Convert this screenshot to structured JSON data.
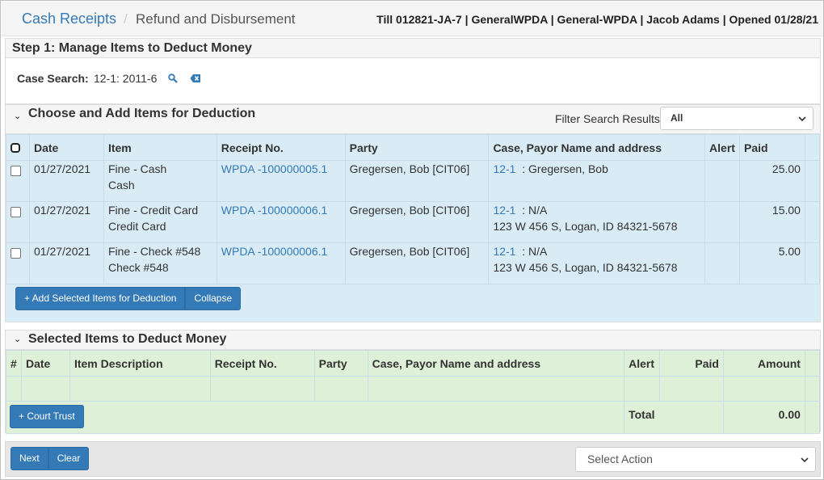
{
  "header": {
    "breadcrumb_root": "Cash Receipts",
    "breadcrumb_sep": "/",
    "breadcrumb_current": "Refund and Disbursement",
    "till_info": "Till 012821-JA-7 | GeneralWPDA | General-WPDA | Jacob Adams | Opened 01/28/21"
  },
  "step1": {
    "title": "Step 1: Manage Items to Deduct Money",
    "case_search_label": "Case Search:",
    "case_search_value": "12-1: 2011-6"
  },
  "choose": {
    "title": "Choose and Add Items for Deduction",
    "filter_label": "Filter Search Results",
    "filter_value": "All",
    "columns": [
      "Date",
      "Item",
      "Receipt No.",
      "Party",
      "Case, Payor Name and address",
      "Alert",
      "Paid"
    ],
    "rows": [
      {
        "date": "01/27/2021",
        "item_line1": "Fine - Cash",
        "item_line2": "Cash",
        "receipt": "WPDA -100000005.1",
        "party": "Gregersen, Bob [CIT06]",
        "case_link": "12-1",
        "payor": ":  Gregersen, Bob",
        "address": "",
        "alert": "",
        "paid": "25.00"
      },
      {
        "date": "01/27/2021",
        "item_line1": "Fine - Credit Card",
        "item_line2": "Credit Card",
        "receipt": "WPDA -100000006.1",
        "party": "Gregersen, Bob [CIT06]",
        "case_link": "12-1",
        "payor": ":  N/A",
        "address": "123 W 456 S, Logan, ID 84321-5678",
        "alert": "",
        "paid": "15.00"
      },
      {
        "date": "01/27/2021",
        "item_line1": "Fine - Check #548",
        "item_line2": "Check #548",
        "receipt": "WPDA -100000006.1",
        "party": "Gregersen, Bob [CIT06]",
        "case_link": "12-1",
        "payor": ":  N/A",
        "address": "123 W 456 S, Logan, ID 84321-5678",
        "alert": "",
        "paid": "5.00"
      }
    ],
    "add_button": "+ Add Selected Items for Deduction",
    "collapse_button": "Collapse"
  },
  "selected": {
    "title": "Selected Items to Deduct Money",
    "columns": [
      "#",
      "Date",
      "Item Description",
      "Receipt No.",
      "Party",
      "Case, Payor Name and address",
      "Alert",
      "Paid",
      "Amount"
    ],
    "court_trust_button": "+ Court Trust",
    "total_label": "Total",
    "total_value": "0.00"
  },
  "footer": {
    "next_button": "Next",
    "clear_button": "Clear",
    "action_placeholder": "Select Action"
  },
  "colors": {
    "link": "#337ab7",
    "button": "#337ab7",
    "choose_bg": "#d9ecf6",
    "selected_bg": "#dff0d8"
  }
}
